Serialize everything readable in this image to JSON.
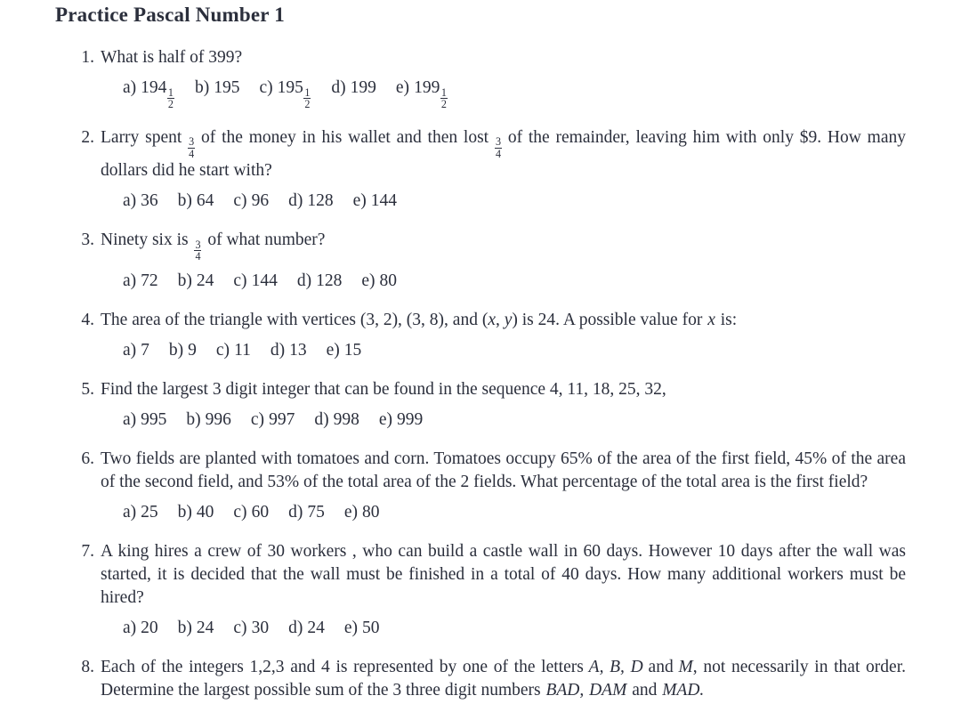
{
  "document": {
    "title": "Practice Pascal Number 1",
    "text_color": "#2b2f3c",
    "background_color": "#ffffff"
  },
  "questions": [
    {
      "number": "1.",
      "text": "What is half of 399?",
      "options": [
        {
          "label": "a)",
          "value": "194½"
        },
        {
          "label": "b)",
          "value": "195"
        },
        {
          "label": "c)",
          "value": "195½"
        },
        {
          "label": "d)",
          "value": "199"
        },
        {
          "label": "e)",
          "value": "199½"
        }
      ]
    },
    {
      "number": "2.",
      "text": "Larry spent 3/4 of the money in his wallet and then lost 3/4 of the remainder, leaving him with only $9. How many dollars did he start with?",
      "text_part_1": "Larry spent",
      "text_part_2": "of the money in his wallet and then lost",
      "text_part_3": "of the remainder, leaving him with only $9. How many dollars did he start with?",
      "options": [
        {
          "label": "a)",
          "value": "36"
        },
        {
          "label": "b)",
          "value": "64"
        },
        {
          "label": "c)",
          "value": "96"
        },
        {
          "label": "d)",
          "value": "128"
        },
        {
          "label": "e)",
          "value": "144"
        }
      ]
    },
    {
      "number": "3.",
      "text": "Ninety six is 3/4 of what number?",
      "text_part_1": "Ninety six is",
      "text_part_2": "of what number?",
      "options": [
        {
          "label": "a)",
          "value": "72"
        },
        {
          "label": "b)",
          "value": "24"
        },
        {
          "label": "c)",
          "value": "144"
        },
        {
          "label": "d)",
          "value": "128"
        },
        {
          "label": "e)",
          "value": "80"
        }
      ]
    },
    {
      "number": "4.",
      "text": "The area of the triangle with vertices (3, 2), (3, 8), and (x, y) is 24. A possible value for x is:",
      "text_part_1": "The area of the triangle with vertices (3, 2), (3, 8), and (",
      "math_x": "x",
      "math_comma": ", ",
      "math_y": "y",
      "text_part_2": ") is 24.  A possible value for",
      "text_part_3": "is:",
      "options": [
        {
          "label": "a)",
          "value": "7"
        },
        {
          "label": "b)",
          "value": "9"
        },
        {
          "label": "c)",
          "value": "11"
        },
        {
          "label": "d)",
          "value": "13"
        },
        {
          "label": "e)",
          "value": "15"
        }
      ]
    },
    {
      "number": "5.",
      "text": "Find the largest 3 digit integer that can be found in the sequence 4, 11, 18, 25, 32,",
      "options": [
        {
          "label": "a)",
          "value": "995"
        },
        {
          "label": "b)",
          "value": "996"
        },
        {
          "label": "c)",
          "value": "997"
        },
        {
          "label": "d)",
          "value": "998"
        },
        {
          "label": "e)",
          "value": "999"
        }
      ]
    },
    {
      "number": "6.",
      "text": "Two fields are planted with tomatoes and corn.  Tomatoes occupy 65% of the area of the first field, 45% of the area of the second field, and 53% of the total area of the 2 fields.  What percentage of the total area is the first field?",
      "options": [
        {
          "label": "a)",
          "value": "25"
        },
        {
          "label": "b)",
          "value": "40"
        },
        {
          "label": "c)",
          "value": "60"
        },
        {
          "label": "d)",
          "value": "75"
        },
        {
          "label": "e)",
          "value": "80"
        }
      ]
    },
    {
      "number": "7.",
      "text": "A king hires a crew of 30 workers , who can build a castle wall in 60 days.  However 10 days after the wall was started, it is decided that the wall must be finished in a total of 40 days.  How many additional workers must be hired?",
      "options": [
        {
          "label": "a)",
          "value": "20"
        },
        {
          "label": "b)",
          "value": "24"
        },
        {
          "label": "c)",
          "value": "30"
        },
        {
          "label": "d)",
          "value": "24"
        },
        {
          "label": "e)",
          "value": "50"
        }
      ]
    },
    {
      "number": "8.",
      "text": "Each of the integers 1,2,3 and 4 is represented by one of the letters A, B, D and M, not necessarily in that order.  Determine the largest possible sum of the 3 three digit numbers BAD, DAM and MAD.",
      "text_part_1": "Each of the integers 1,2,3 and 4 is represented by one of the letters",
      "math_letters": "A, B, D",
      "text_part_2": "and",
      "math_m": "M",
      "text_part_3": ", not necessarily in that order.  Determine the largest possible sum of the 3 three digit numbers",
      "math_bad": "BAD,",
      "math_dam": "DAM",
      "text_part_4": "and",
      "math_mad": "MAD.",
      "options": []
    }
  ],
  "fractions": {
    "three_quarters": {
      "numerator": "3",
      "denominator": "4"
    },
    "one_half": {
      "numerator": "1",
      "denominator": "2"
    }
  }
}
